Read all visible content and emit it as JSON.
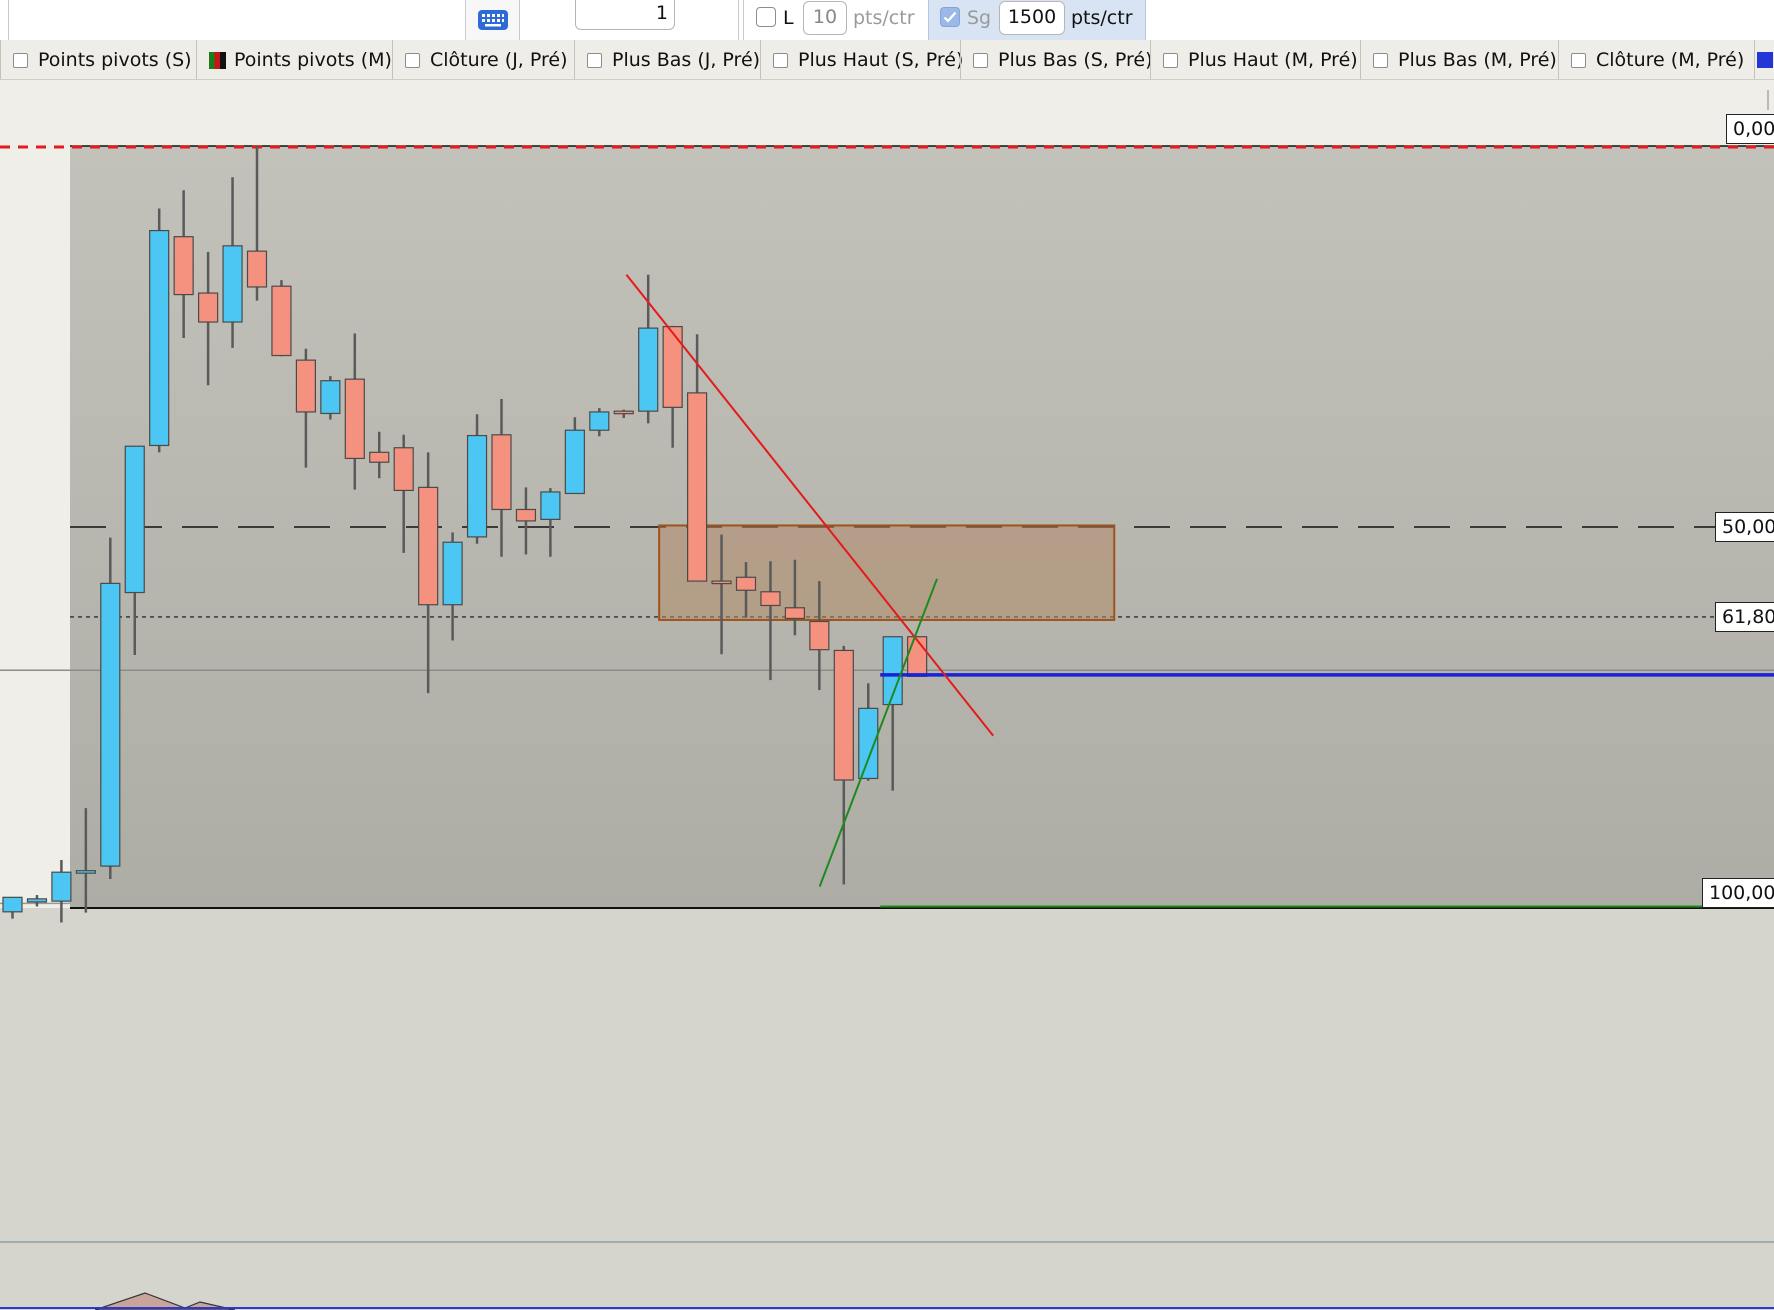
{
  "toolbar": {
    "quantity_value": "1",
    "l_label": "L",
    "l_value": "10",
    "l_unit": "pts/ctr",
    "sg_label": "Sg",
    "sg_value": "1500",
    "sg_unit": "pts/ctr",
    "l_checked": false,
    "sg_checked": true
  },
  "indicators": [
    {
      "label": "Points pivots (S)",
      "checked": false
    },
    {
      "label": "Points pivots (M)",
      "checked": true
    },
    {
      "label": "Clôture (J, Pré)",
      "checked": false
    },
    {
      "label": "Plus Bas (J, Pré)",
      "checked": false
    },
    {
      "label": "Plus Haut (S, Pré)",
      "checked": false
    },
    {
      "label": "Plus Bas (S, Pré)",
      "checked": false
    },
    {
      "label": "Plus Haut (M, Pré)",
      "checked": false
    },
    {
      "label": "Plus Bas (M, Pré)",
      "checked": false
    },
    {
      "label": "Clôture (M, Pré)",
      "checked": false
    }
  ],
  "fib_labels": {
    "level_0": "0,00",
    "level_50": "50,00",
    "level_618": "61,80",
    "level_100": "100,00"
  },
  "colors": {
    "bull_candle": "#4cc6f2",
    "bear_candle": "#f4917f",
    "wick": "#5a5a5a",
    "trend_down": "#e31b1b",
    "trend_up": "#1e8a1e",
    "blue_level": "#1a22d6",
    "zone_fill": "#b08a6a",
    "zone_border": "#a0521a",
    "red_dashed": "#e31b1b",
    "fib_area": "#c3c2ba"
  },
  "chart_data": {
    "type": "candlestick",
    "note_units": "0 = top fibonacci level (0,00), 100 = bottom level (100,00)",
    "candles": [
      {
        "o": 100.5,
        "h": 100.0,
        "l": 101.4,
        "c": 98.6
      },
      {
        "o": 99.2,
        "h": 98.3,
        "l": 99.8,
        "c": 98.8
      },
      {
        "o": 99.1,
        "h": 93.7,
        "l": 101.9,
        "c": 95.3
      },
      {
        "o": 95.3,
        "h": 86.9,
        "l": 100.6,
        "c": 95.1
      },
      {
        "o": 94.5,
        "h": 51.4,
        "l": 96.2,
        "c": 57.4
      },
      {
        "o": 58.6,
        "h": 40.1,
        "l": 66.8,
        "c": 39.4
      },
      {
        "o": 39.3,
        "h": 8.2,
        "l": 40.2,
        "c": 11.1
      },
      {
        "o": 11.9,
        "h": 5.8,
        "l": 25.2,
        "c": 19.5
      },
      {
        "o": 19.3,
        "h": 13.9,
        "l": 31.4,
        "c": 23.1
      },
      {
        "o": 23.1,
        "h": 4.1,
        "l": 26.5,
        "c": 13.1
      },
      {
        "o": 13.8,
        "h": 0.0,
        "l": 20.3,
        "c": 18.5
      },
      {
        "o": 18.4,
        "h": 17.6,
        "l": 27.6,
        "c": 27.5
      },
      {
        "o": 28.1,
        "h": 26.6,
        "l": 42.2,
        "c": 34.9
      },
      {
        "o": 35.1,
        "h": 30.2,
        "l": 35.9,
        "c": 30.8
      },
      {
        "o": 30.6,
        "h": 24.6,
        "l": 45.1,
        "c": 41.0
      },
      {
        "o": 40.2,
        "h": 37.5,
        "l": 43.6,
        "c": 41.5
      },
      {
        "o": 39.6,
        "h": 37.9,
        "l": 53.4,
        "c": 45.2
      },
      {
        "o": 44.8,
        "h": 40.2,
        "l": 71.8,
        "c": 60.2
      },
      {
        "o": 60.2,
        "h": 50.7,
        "l": 64.9,
        "c": 52.0
      },
      {
        "o": 51.3,
        "h": 35.2,
        "l": 52.2,
        "c": 38.0
      },
      {
        "o": 37.9,
        "h": 33.2,
        "l": 53.9,
        "c": 47.7
      },
      {
        "o": 47.7,
        "h": 44.8,
        "l": 53.6,
        "c": 49.2
      },
      {
        "o": 49.0,
        "h": 44.9,
        "l": 53.9,
        "c": 45.4
      },
      {
        "o": 45.6,
        "h": 35.6,
        "l": 43.4,
        "c": 37.3
      },
      {
        "o": 37.3,
        "h": 34.4,
        "l": 38.1,
        "c": 34.9
      },
      {
        "o": 34.8,
        "h": 34.6,
        "l": 35.7,
        "c": 35.1
      },
      {
        "o": 34.8,
        "h": 16.9,
        "l": 36.4,
        "c": 23.9
      },
      {
        "o": 23.7,
        "h": 23.6,
        "l": 39.6,
        "c": 34.3
      },
      {
        "o": 32.4,
        "h": 24.7,
        "l": 50.4,
        "c": 57.1
      },
      {
        "o": 57.1,
        "h": 51.0,
        "l": 66.7,
        "c": 57.2
      },
      {
        "o": 56.6,
        "h": 54.6,
        "l": 61.9,
        "c": 58.3
      },
      {
        "o": 58.5,
        "h": 54.5,
        "l": 70.1,
        "c": 60.3
      },
      {
        "o": 60.6,
        "h": 54.3,
        "l": 64.2,
        "c": 62.0
      },
      {
        "o": 62.4,
        "h": 57.1,
        "l": 71.4,
        "c": 66.1
      },
      {
        "o": 66.2,
        "h": 65.6,
        "l": 96.9,
        "c": 83.2
      },
      {
        "o": 83.0,
        "h": 70.5,
        "l": 83.3,
        "c": 73.8
      },
      {
        "o": 73.3,
        "h": 64.6,
        "l": 84.6,
        "c": 64.4
      },
      {
        "o": 64.4,
        "h": 64.3,
        "l": 69.5,
        "c": 69.6
      }
    ],
    "fib_levels": [
      0,
      50,
      61.8,
      100
    ],
    "blue_level": 69.4,
    "zone": {
      "top": 49.8,
      "bottom": 62.2,
      "from_candle": 27,
      "to_candle": 45
    },
    "trend_down": {
      "from": [
        25.5,
        16.9
      ],
      "to": [
        40.5,
        77.4
      ]
    },
    "trend_up": {
      "from": [
        33.4,
        97.2
      ],
      "to": [
        38.2,
        56.8
      ]
    }
  }
}
